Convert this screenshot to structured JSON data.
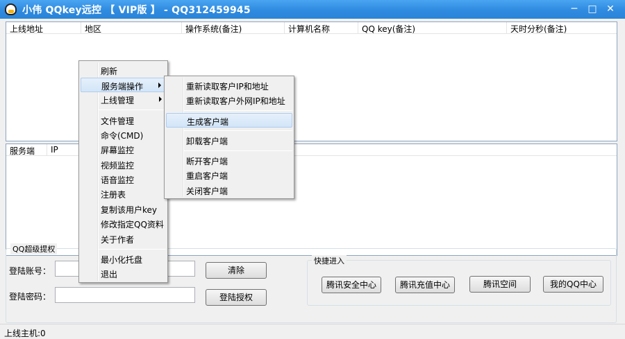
{
  "window": {
    "title": "小伟 QQkey远控 【 VIP版 】 - QQ312459945",
    "minimize_glyph": "─",
    "maximize_glyph": "□",
    "close_glyph": "✕"
  },
  "online_list": {
    "columns": [
      "上线地址",
      "地区",
      "操作系统(备注)",
      "计算机名称",
      "QQ key(备注)",
      "天时分秒(备注)"
    ]
  },
  "server_list": {
    "columns": [
      "服务端",
      "IP"
    ]
  },
  "context_menu": {
    "items": [
      {
        "label": "刷新"
      },
      {
        "label": "服务端操作"
      },
      {
        "label": "上线管理"
      },
      {
        "label": "文件管理"
      },
      {
        "label": "命令(CMD)"
      },
      {
        "label": "屏幕监控"
      },
      {
        "label": "视频监控"
      },
      {
        "label": "语音监控"
      },
      {
        "label": "注册表"
      },
      {
        "label": "复制该用户key"
      },
      {
        "label": "修改指定QQ资料"
      },
      {
        "label": "关于作者"
      },
      {
        "label": "最小化托盘"
      },
      {
        "label": "退出"
      }
    ]
  },
  "submenu": {
    "items": [
      {
        "label": "重新读取客户IP和地址"
      },
      {
        "label": "重新读取客户外网IP和地址"
      },
      {
        "label": "生成客户端"
      },
      {
        "label": "卸载客户端"
      },
      {
        "label": "断开客户端"
      },
      {
        "label": "重启客户端"
      },
      {
        "label": "关闭客户端"
      }
    ]
  },
  "auth_group": {
    "title": "QQ超级提权",
    "account_label": "登陆账号：",
    "account_value": "",
    "password_label": "登陆密码：",
    "password_value": "",
    "clear_button": "清除",
    "login_button": "登陆授权"
  },
  "quick_group": {
    "title": "快捷进入",
    "buttons": [
      "腾讯安全中心",
      "腾讯充值中心",
      "腾讯空间",
      "我的QQ中心"
    ]
  },
  "status_bar": {
    "text": "上线主机:0"
  }
}
